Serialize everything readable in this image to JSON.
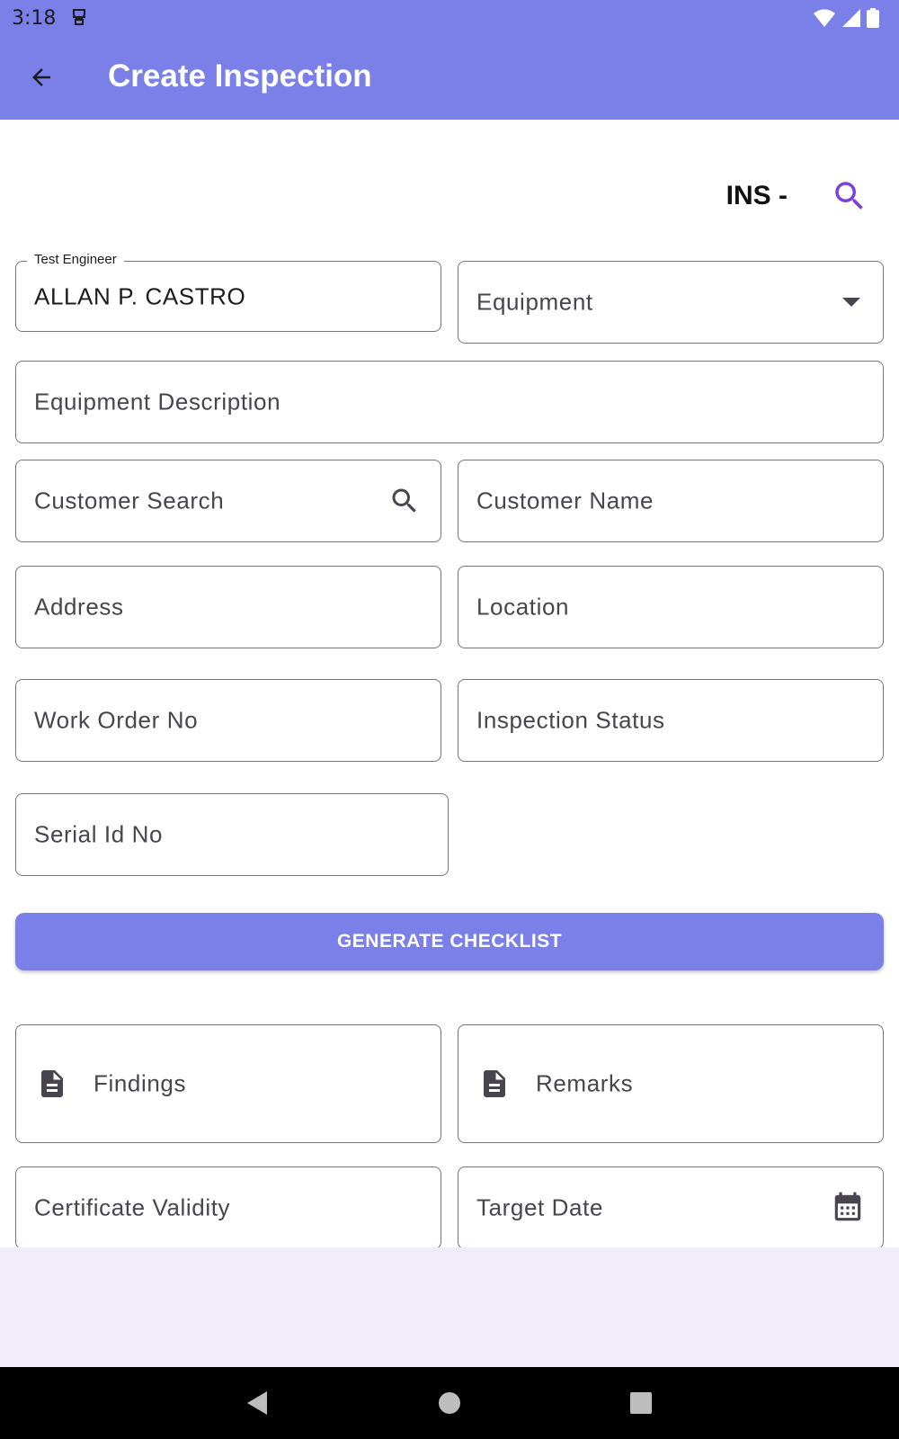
{
  "status_bar": {
    "time": "3:18"
  },
  "app_bar": {
    "title": "Create Inspection"
  },
  "inspection": {
    "number_label": "INS -"
  },
  "form": {
    "test_engineer": {
      "label": "Test Engineer",
      "value": "ALLAN P. CASTRO"
    },
    "equipment": {
      "placeholder": "Equipment"
    },
    "equipment_description": {
      "placeholder": "Equipment Description"
    },
    "customer_search": {
      "placeholder": "Customer Search"
    },
    "customer_name": {
      "placeholder": "Customer Name"
    },
    "address": {
      "placeholder": "Address"
    },
    "location": {
      "placeholder": "Location"
    },
    "work_order_no": {
      "placeholder": "Work Order No"
    },
    "inspection_status": {
      "placeholder": "Inspection Status"
    },
    "serial_id_no": {
      "placeholder": "Serial Id No"
    },
    "generate_button": "GENERATE CHECKLIST",
    "findings": {
      "placeholder": "Findings"
    },
    "remarks": {
      "placeholder": "Remarks"
    },
    "certificate_validity": {
      "placeholder": "Certificate Validity"
    },
    "target_date": {
      "placeholder": "Target Date"
    }
  },
  "colors": {
    "primary": "#7b80e8",
    "accent_icon": "#7d3fe0",
    "outline": "#79747e",
    "bottom_surface": "#f2ecf8"
  },
  "icons": [
    "back-arrow-icon",
    "search-icon",
    "dropdown-arrow-icon",
    "document-icon",
    "calendar-icon",
    "wifi-icon",
    "signal-icon",
    "battery-icon"
  ]
}
